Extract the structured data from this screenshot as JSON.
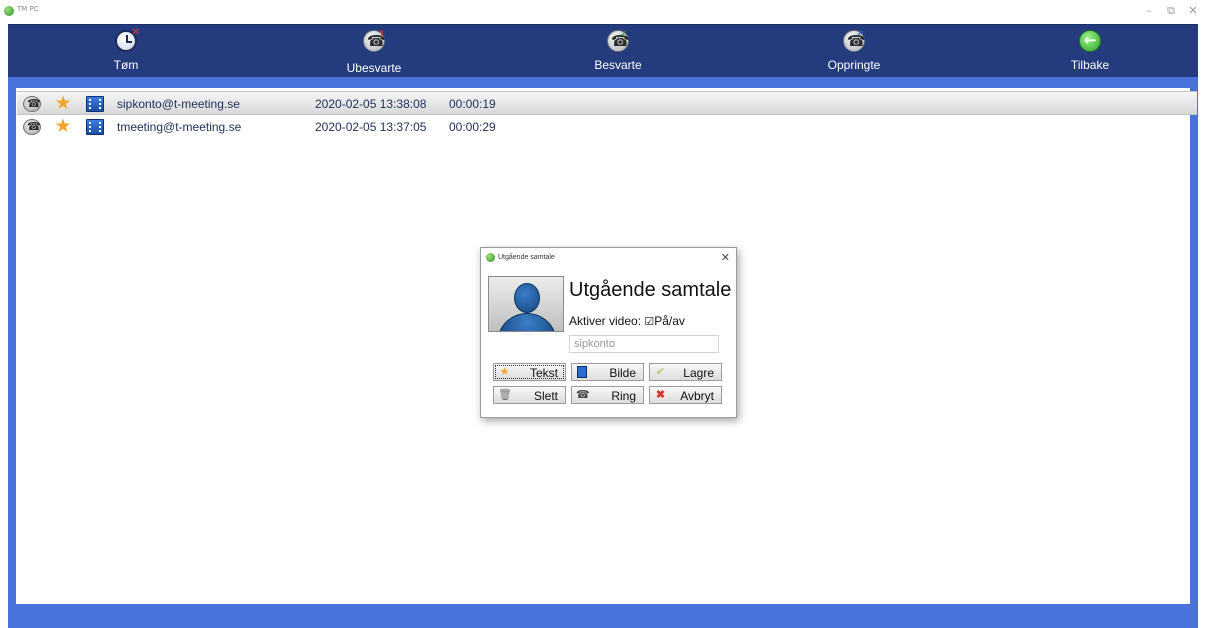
{
  "window": {
    "title": "TM PC",
    "controls": {
      "minimize": "–",
      "restore": "⧉",
      "close": "✕"
    }
  },
  "toolbar": {
    "items": [
      {
        "label": "Tøm",
        "icon": "clear-history-icon"
      },
      {
        "label": "Ubesvarte",
        "icon": "missed-calls-icon"
      },
      {
        "label": "Besvarte",
        "icon": "answered-calls-icon"
      },
      {
        "label": "Oppringte",
        "icon": "dialed-calls-icon"
      },
      {
        "label": "Tilbake",
        "icon": "back-arrow-icon"
      }
    ]
  },
  "call_log": {
    "rows": [
      {
        "contact": "sipkonto@t-meeting.se",
        "datetime": "2020-02-05 13:38:08",
        "duration": "00:00:19",
        "selected": true
      },
      {
        "contact": "tmeeting@t-meeting.se",
        "datetime": "2020-02-05 13:37:05",
        "duration": "00:00:29",
        "selected": false
      }
    ],
    "row_icons": [
      "call-icon",
      "favorite-star-icon",
      "video-film-icon"
    ]
  },
  "dialog": {
    "title": "Utgående samtale",
    "close": "✕",
    "heading": "Utgående samtale",
    "video_label": "Aktiver video:",
    "video_checkbox": "☑",
    "video_option": "På/av",
    "video_enabled": true,
    "account_value": "sipkonto",
    "buttons": [
      {
        "label": "Tekst",
        "icon": "star-icon"
      },
      {
        "label": "Bilde",
        "icon": "film-icon"
      },
      {
        "label": "Lagre",
        "icon": "check-icon"
      },
      {
        "label": "Slett",
        "icon": "trash-icon"
      },
      {
        "label": "Ring",
        "icon": "phone-icon"
      },
      {
        "label": "Avbryt",
        "icon": "cancel-x-icon"
      }
    ]
  },
  "colors": {
    "toolbar_bg": "#243b7d",
    "frame_blue": "#4a72db",
    "text_dark_blue": "#1f2f5a",
    "star": "#f2a52c",
    "cancel_red": "#d9332b"
  }
}
